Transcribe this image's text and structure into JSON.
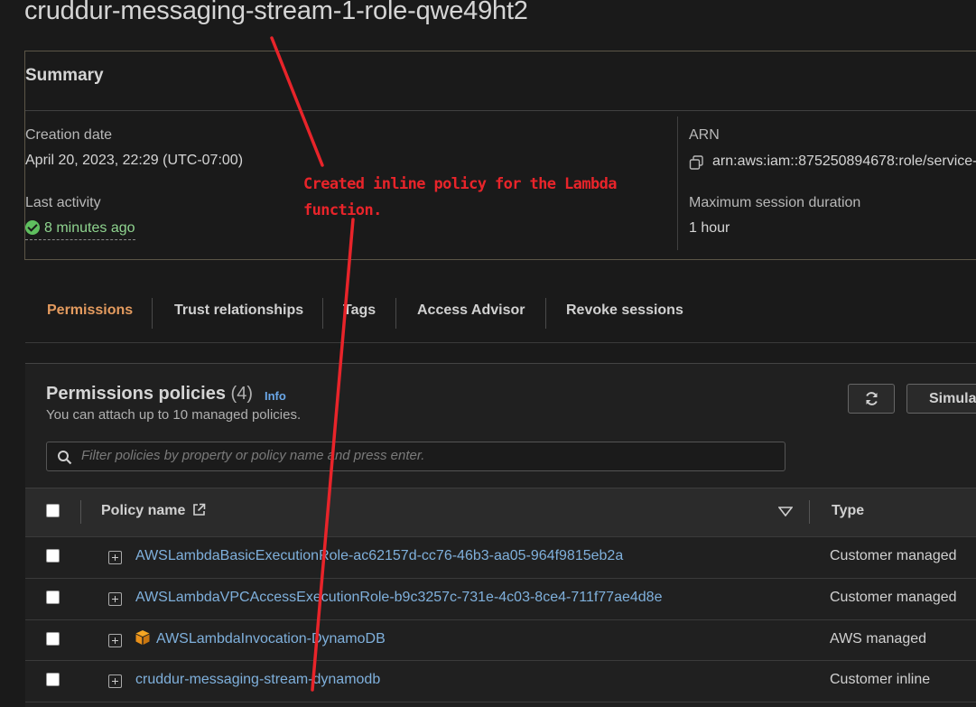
{
  "page": {
    "role_name": "cruddur-messaging-stream-1-role-qwe49ht2"
  },
  "summary": {
    "title": "Summary",
    "creation_date_label": "Creation date",
    "creation_date_value": "April 20, 2023, 22:29 (UTC-07:00)",
    "last_activity_label": "Last activity",
    "last_activity_value": "8 minutes ago",
    "arn_label": "ARN",
    "arn_value": "arn:aws:iam::875250894678:role/service-r",
    "max_session_label": "Maximum session duration",
    "max_session_value": "1 hour"
  },
  "tabs": [
    {
      "label": "Permissions",
      "active": true
    },
    {
      "label": "Trust relationships",
      "active": false
    },
    {
      "label": "Tags",
      "active": false
    },
    {
      "label": "Access Advisor",
      "active": false
    },
    {
      "label": "Revoke sessions",
      "active": false
    }
  ],
  "permissions": {
    "title": "Permissions policies",
    "count": "(4)",
    "info_label": "Info",
    "subtitle": "You can attach up to 10 managed policies.",
    "simulate_label": "Simula",
    "search_placeholder": "Filter policies by property or policy name and press enter.",
    "columns": {
      "policy_name": "Policy name",
      "type": "Type"
    },
    "rows": [
      {
        "name": "AWSLambdaBasicExecutionRole-ac62157d-cc76-46b3-aa05-964f9815eb2a",
        "type": "Customer managed",
        "aws_icon": false
      },
      {
        "name": "AWSLambdaVPCAccessExecutionRole-b9c3257c-731e-4c03-8ce4-711f77ae4d8e",
        "type": "Customer managed",
        "aws_icon": false
      },
      {
        "name": "AWSLambdaInvocation-DynamoDB",
        "type": "AWS managed",
        "aws_icon": true
      },
      {
        "name": "cruddur-messaging-stream-dynamodb",
        "type": "Customer inline",
        "aws_icon": false
      }
    ]
  },
  "annotation": {
    "text": "Created inline policy for the Lambda function.",
    "color": "#e8242a"
  },
  "colors": {
    "active_tab": "#e49b5f",
    "link": "#7fb0dc",
    "success": "#8fd48f"
  }
}
